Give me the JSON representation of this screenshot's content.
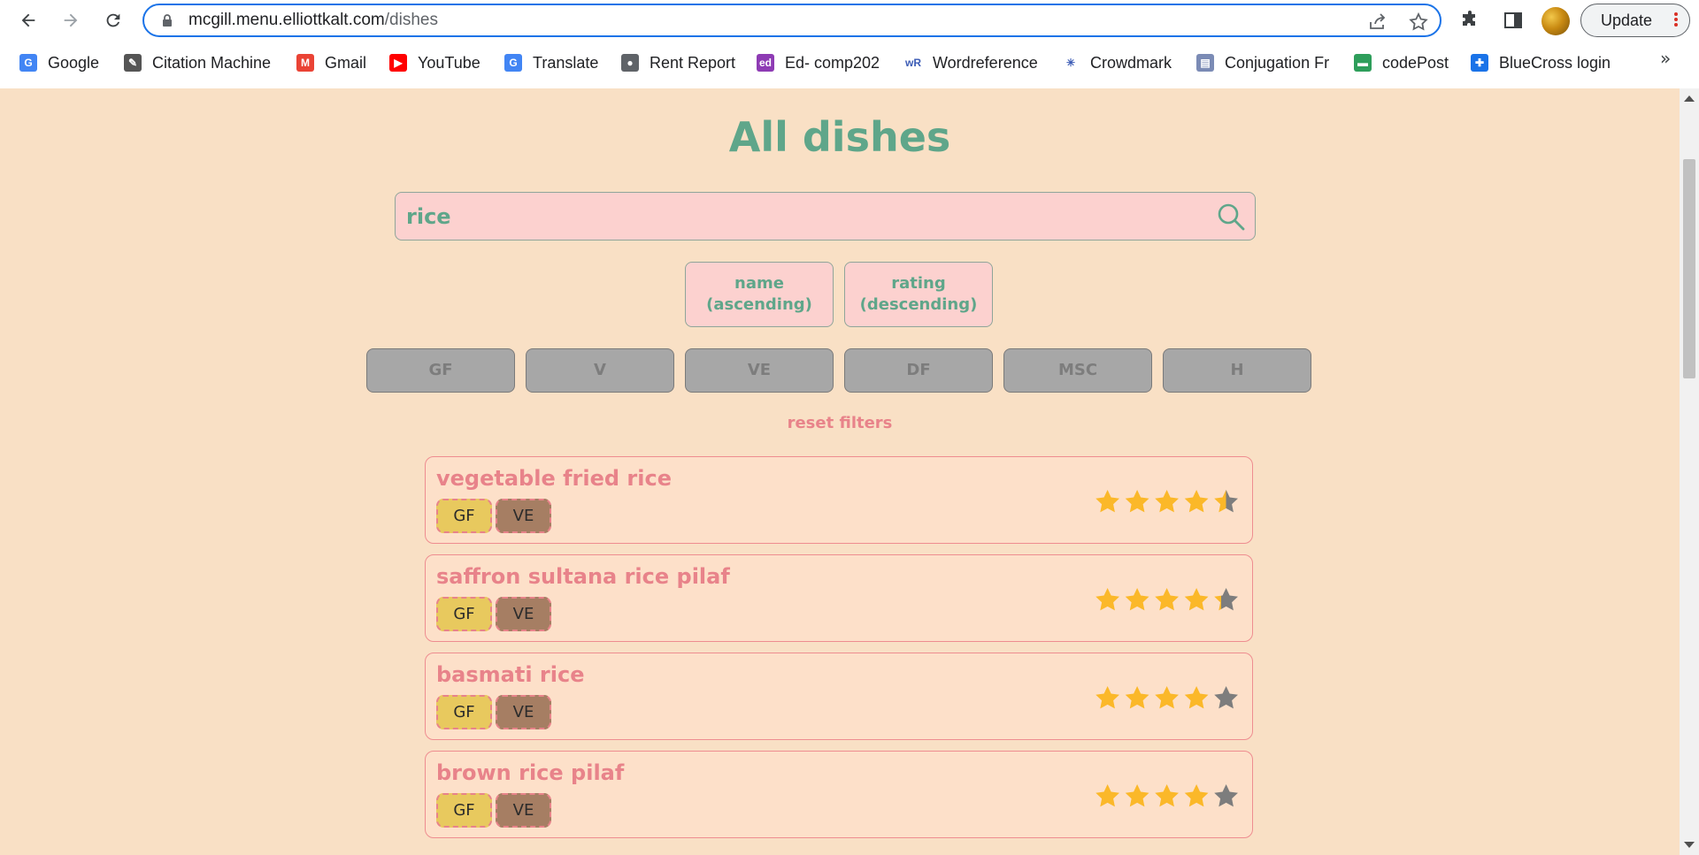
{
  "browser": {
    "url_domain": "mcgill.menu.elliottkalt.com",
    "url_path": "/dishes",
    "update_label": "Update",
    "bookmarks": [
      {
        "label": "Google",
        "icon": "google-icon",
        "color": "#4285f4",
        "glyph": "G"
      },
      {
        "label": "Citation Machine",
        "icon": "citation-machine-icon",
        "color": "#555555",
        "glyph": "✎"
      },
      {
        "label": "Gmail",
        "icon": "gmail-icon",
        "color": "#ea4335",
        "glyph": "M"
      },
      {
        "label": "YouTube",
        "icon": "youtube-icon",
        "color": "#ff0000",
        "glyph": "▶"
      },
      {
        "label": "Translate",
        "icon": "translate-icon",
        "color": "#4285f4",
        "glyph": "G"
      },
      {
        "label": "Rent Report",
        "icon": "globe-icon",
        "color": "#5f6368",
        "glyph": "●"
      },
      {
        "label": "Ed- comp202",
        "icon": "ed-icon",
        "color": "#8e3bb4",
        "glyph": "ed"
      },
      {
        "label": "Wordreference",
        "icon": "wordreference-icon",
        "color": "#ffffff",
        "glyph": "wR"
      },
      {
        "label": "Crowdmark",
        "icon": "crowdmark-icon",
        "color": "#ffffff",
        "glyph": "✳"
      },
      {
        "label": "Conjugation Fr",
        "icon": "conjugation-icon",
        "color": "#7b8bb5",
        "glyph": "▤"
      },
      {
        "label": "codePost",
        "icon": "codepost-icon",
        "color": "#2e9e5b",
        "glyph": "▬"
      },
      {
        "label": "BlueCross login",
        "icon": "bluecross-icon",
        "color": "#1a73e8",
        "glyph": "✚"
      }
    ]
  },
  "page": {
    "title": "All dishes",
    "search": {
      "value": "rice",
      "placeholder": ""
    },
    "sort_buttons": [
      {
        "line1": "name",
        "line2": "(ascending)"
      },
      {
        "line1": "rating",
        "line2": "(descending)"
      }
    ],
    "filters": [
      "GF",
      "V",
      "VE",
      "DF",
      "MSC",
      "H"
    ],
    "reset_label": "reset filters",
    "dishes": [
      {
        "name": "vegetable fried rice",
        "tags": [
          "GF",
          "VE"
        ],
        "rating": 4.5
      },
      {
        "name": "saffron sultana rice pilaf",
        "tags": [
          "GF",
          "VE"
        ],
        "rating": 4.3
      },
      {
        "name": "basmati rice",
        "tags": [
          "GF",
          "VE"
        ],
        "rating": 4.0
      },
      {
        "name": "brown rice pilaf",
        "tags": [
          "GF",
          "VE"
        ],
        "rating": 4.0
      }
    ],
    "colors": {
      "background": "#f9e0c5",
      "accent_green": "#5fa68a",
      "accent_pink": "#e8838a",
      "star_filled": "#fbb829",
      "star_empty": "#7d7d7d"
    }
  }
}
